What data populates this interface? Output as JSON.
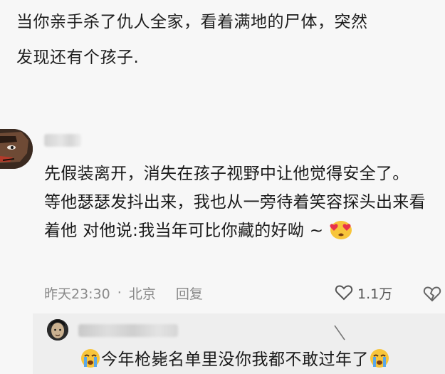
{
  "post": {
    "line1": "当你亲手杀了仇人全家，看着满地的尸体，突然",
    "line2": "发现还有个孩子."
  },
  "comment": {
    "text_part1": "先假装离开，消失在孩子视野中让他觉得安全了。",
    "text_part2": "等他瑟瑟发抖出来，我也从一旁待着笑容探头出来看着他 对他说:我当年可比你藏的好呦 ~",
    "emoji": "heart-eyes-emoji",
    "time": "昨天23:30",
    "separator": "·",
    "location": "北京",
    "reply_label": "回复",
    "like_count": "1.1万"
  },
  "reply": {
    "text": "今年枪毙名单里没你我都不敢过年了",
    "emoji": "crying-emoji"
  },
  "colors": {
    "background": "#f7f7f7",
    "reply_background": "#eeeeee",
    "meta_text": "#8a8a8a",
    "emoji_yellow": "#f7c53b",
    "heart_red": "#e8324a"
  }
}
